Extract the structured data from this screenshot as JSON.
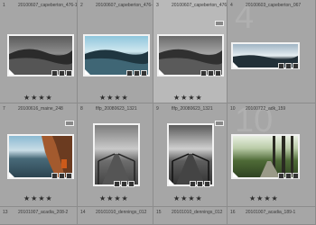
{
  "cells": [
    {
      "num": "1",
      "file": "20100607_capeberton_476-1",
      "stars": "★★★★",
      "big": ""
    },
    {
      "num": "2",
      "file": "20100607_capeberton_476-1",
      "stars": "★★★★",
      "big": ""
    },
    {
      "num": "3",
      "file": "20100607_capeberton_476-1",
      "stars": "★★★★",
      "big": ""
    },
    {
      "num": "4",
      "file": "20100603_capeberton_067",
      "stars": "",
      "big": "4"
    },
    {
      "num": "7",
      "file": "20100616_maine_248",
      "stars": "★★★★",
      "big": ""
    },
    {
      "num": "8",
      "file": "flfp_20080623_1321",
      "stars": "★★★★",
      "big": ""
    },
    {
      "num": "9",
      "file": "flfp_20080623_1321",
      "stars": "★★★★",
      "big": ""
    },
    {
      "num": "10",
      "file": "20100722_adk_159",
      "stars": "★★★★",
      "big": "10"
    },
    {
      "num": "13",
      "file": "20101007_acadia_208-2",
      "stars": "",
      "big": ""
    },
    {
      "num": "14",
      "file": "20101010_dennings_012",
      "stars": "",
      "big": ""
    },
    {
      "num": "15",
      "file": "20101010_dennings_012",
      "stars": "",
      "big": ""
    },
    {
      "num": "16",
      "file": "20101007_acadia_189-1",
      "stars": "",
      "big": ""
    }
  ]
}
